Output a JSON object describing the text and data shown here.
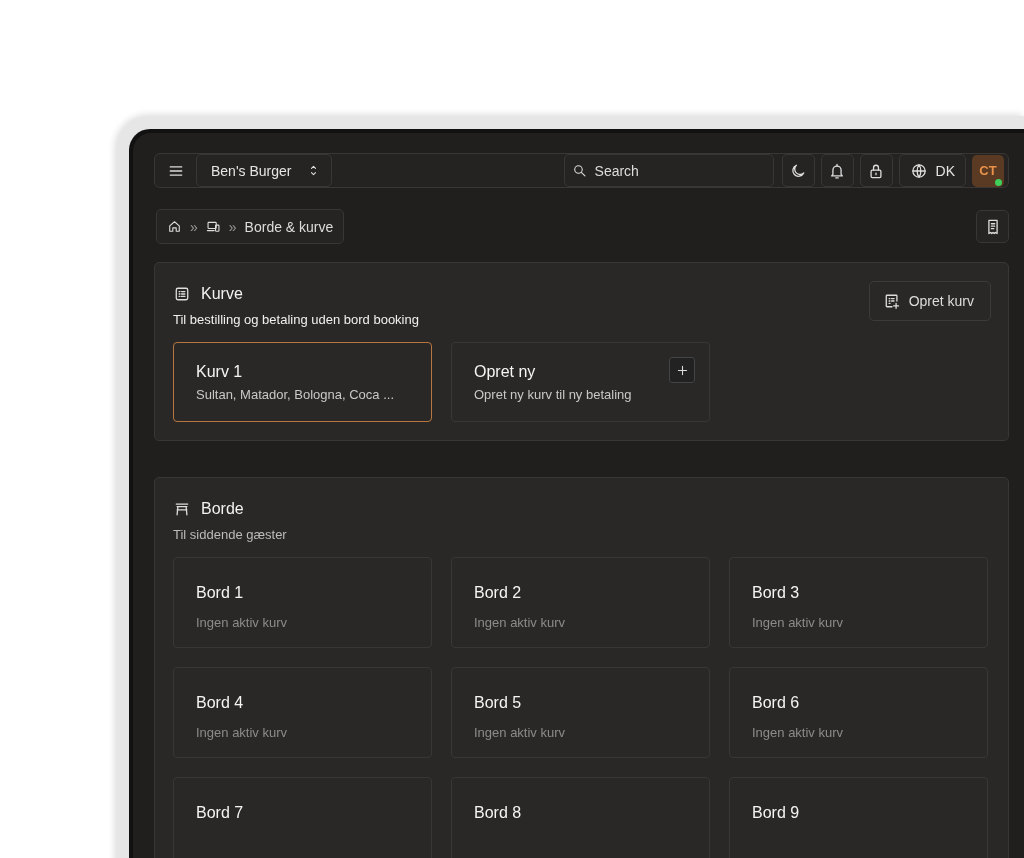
{
  "topbar": {
    "store": "Ben's Burger",
    "search": {
      "placeholder": "Search"
    },
    "language": "DK",
    "avatar": {
      "initials": "CT",
      "online": true
    }
  },
  "breadcrumb": {
    "separator": "»",
    "items": [
      {
        "kind": "home"
      },
      {
        "kind": "devices"
      },
      {
        "kind": "text",
        "label": "Borde & kurve"
      }
    ]
  },
  "baskets": {
    "title": "Kurve",
    "subtitle": "Til bestilling og betaling uden bord booking",
    "button": "Opret kurv",
    "cards": [
      {
        "kind": "basket",
        "title": "Kurv 1",
        "subtitle": "Sultan, Matador, Bologna, Coca ...",
        "selected": true
      },
      {
        "kind": "new",
        "title": "Opret ny",
        "subtitle": "Opret ny kurv til ny betaling",
        "selected": false
      }
    ]
  },
  "tables": {
    "title": "Borde",
    "subtitle": "Til siddende gæster",
    "cards": [
      {
        "title": "Bord 1",
        "subtitle": "Ingen aktiv kurv"
      },
      {
        "title": "Bord 2",
        "subtitle": "Ingen aktiv kurv"
      },
      {
        "title": "Bord 3",
        "subtitle": "Ingen aktiv kurv"
      },
      {
        "title": "Bord 4",
        "subtitle": "Ingen aktiv kurv"
      },
      {
        "title": "Bord 5",
        "subtitle": "Ingen aktiv kurv"
      },
      {
        "title": "Bord 6",
        "subtitle": "Ingen aktiv kurv"
      },
      {
        "title": "Bord 7"
      },
      {
        "title": "Bord 8"
      },
      {
        "title": "Bord 9"
      }
    ]
  }
}
